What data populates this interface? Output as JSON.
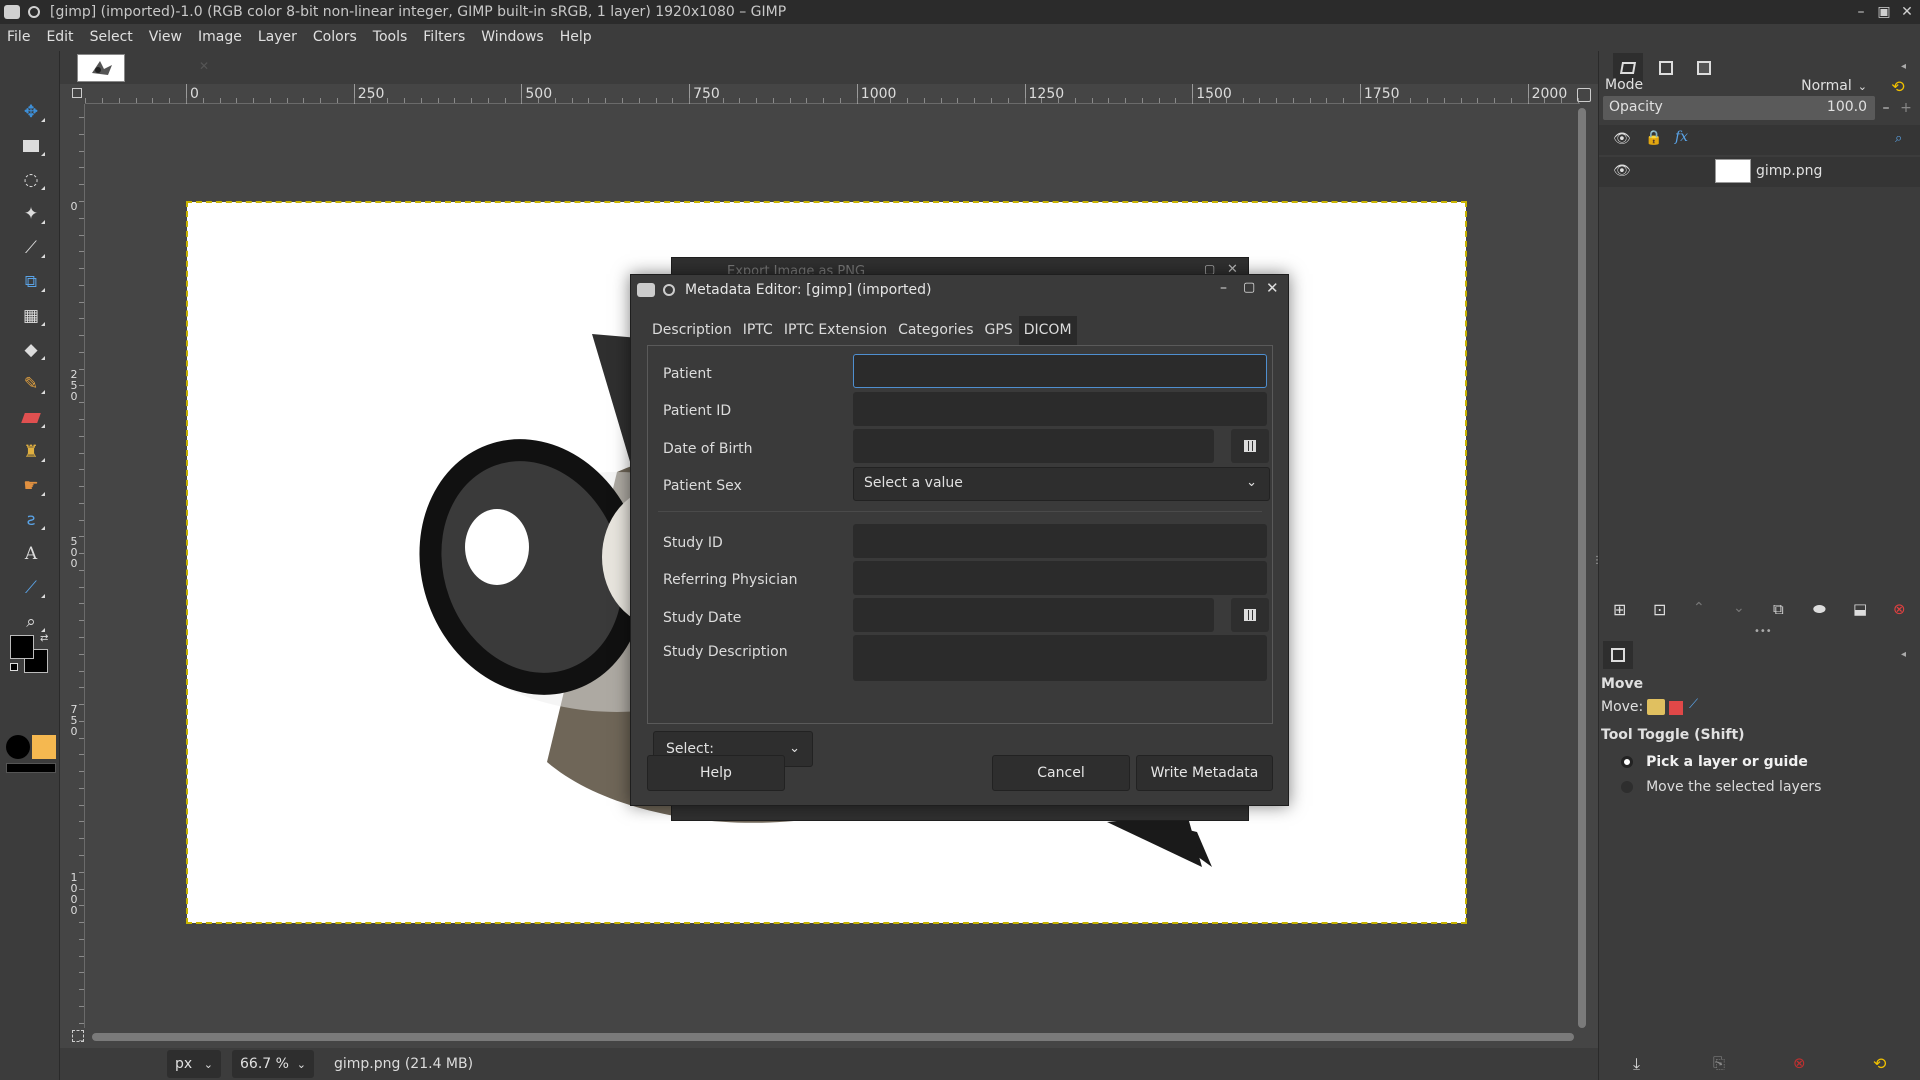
{
  "window": {
    "title": "[gimp] (imported)-1.0 (RGB color 8-bit non-linear integer, GIMP built-in sRGB, 1 layer) 1920x1080 – GIMP"
  },
  "menu": [
    "File",
    "Edit",
    "Select",
    "View",
    "Image",
    "Layer",
    "Colors",
    "Tools",
    "Filters",
    "Windows",
    "Help"
  ],
  "ruler": {
    "h": [
      "0",
      "250",
      "500",
      "750",
      "1000",
      "1250",
      "1500",
      "1750",
      "2000"
    ],
    "v": [
      "0",
      "250",
      "500",
      "750",
      "1000"
    ]
  },
  "statusbar": {
    "unit": "px",
    "zoom": "66.7 %",
    "file_info": "gimp.png (21.4 MB)"
  },
  "layers": {
    "mode_label": "Mode",
    "mode_value": "Normal",
    "opacity_label": "Opacity",
    "opacity_value": "100.0",
    "layer_name": "gimp.png"
  },
  "tool_options": {
    "title": "Move",
    "move_label": "Move:",
    "toggle_label": "Tool Toggle  (Shift)",
    "options": [
      "Pick a layer or guide",
      "Move the selected layers"
    ]
  },
  "ghost_dialog": {
    "title": "Export Image as PNG"
  },
  "dialog": {
    "title": "Metadata Editor: [gimp] (imported)",
    "tabs": [
      "Description",
      "IPTC",
      "IPTC Extension",
      "Categories",
      "GPS",
      "DICOM"
    ],
    "fields": {
      "patient": "Patient",
      "patient_id": "Patient ID",
      "dob": "Date of Birth",
      "patient_sex": "Patient Sex",
      "patient_sex_value": "Select a value",
      "study_id": "Study ID",
      "referring_physician": "Referring Physician",
      "study_date": "Study Date",
      "study_description": "Study Description"
    },
    "select_label": "Select:",
    "help": "Help",
    "cancel": "Cancel",
    "write": "Write Metadata"
  },
  "colors": {
    "accent": "#3d8fd8",
    "bg": "#454545",
    "panel": "#3c3c3c"
  }
}
